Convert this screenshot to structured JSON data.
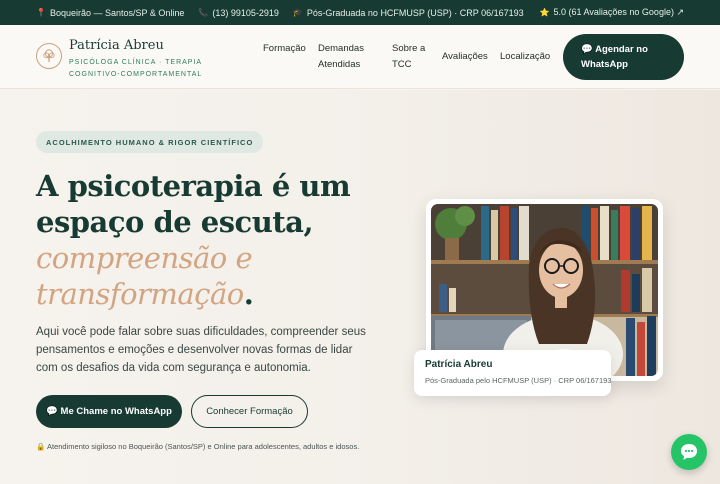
{
  "topbar": {
    "location": "Boqueirão — Santos/SP & Online",
    "phone": "(13) 99105-2919",
    "credential": "Pós-Graduada no HCFMUSP (USP) · CRP 06/167193",
    "rating": "5.0 (61 Avaliações no Google) ↗",
    "icons": {
      "location": "pin-icon",
      "phone": "phone-icon",
      "credential": "graduation-cap-icon",
      "rating": "star-icon"
    }
  },
  "header": {
    "brand_name": "Patrícia Abreu",
    "brand_subtitle": "Psicóloga Clínica · Terapia Cognitivo-Comportamental",
    "nav": [
      "Formação",
      "Demandas Atendidas",
      "Sobre a TCC",
      "Avaliações",
      "Localização"
    ],
    "cta_label": "💬 Agendar no WhatsApp"
  },
  "hero": {
    "badge": "ACOLHIMENTO HUMANO & RIGOR CIENTÍFICO",
    "headline_line1": "A psicoterapia é um",
    "headline_line2": "espaço de escuta,",
    "headline_accent1": "compreensão e",
    "headline_accent2": "transformação",
    "headline_period": ".",
    "description": "Aqui você pode falar sobre suas dificuldades, compreender seus pensamentos e emoções e desenvolver novas formas de lidar com os desafios da vida com segurança e autonomia.",
    "primary_button": "💬 Me Chame no WhatsApp",
    "secondary_button": "Conhecer Formação",
    "note": "🔒 Atendimento sigiloso no Boqueirão (Santos/SP) e Online para adolescentes, adultos e idosos."
  },
  "profile_card": {
    "name": "Patrícia Abreu",
    "credential": "Pós-Graduada pelo HCFMUSP (USP) · CRP 06/167193"
  },
  "colors": {
    "brand_dark": "#173b33",
    "accent": "#d3a482",
    "whatsapp": "#25c466",
    "background": "#f7f3ee"
  }
}
